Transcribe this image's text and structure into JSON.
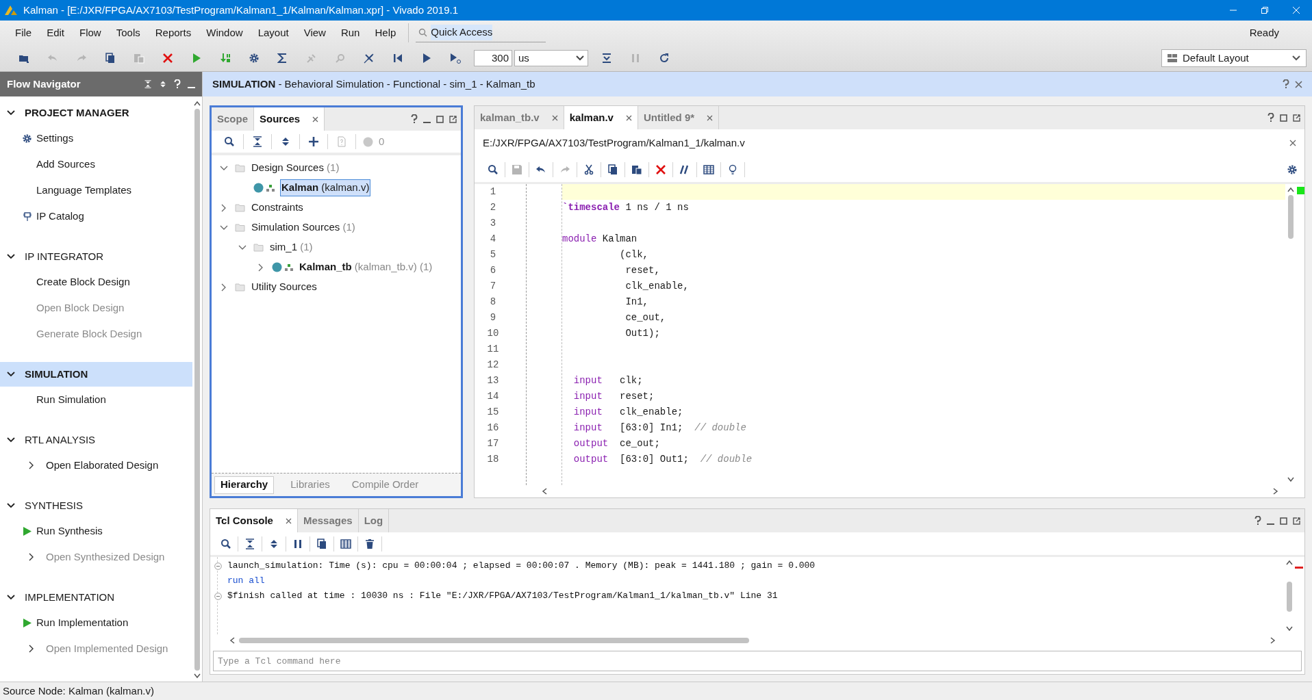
{
  "window": {
    "title": "Kalman - [E:/JXR/FPGA/AX7103/TestProgram/Kalman1_1/Kalman/Kalman.xpr] - Vivado 2019.1"
  },
  "menu": [
    "File",
    "Edit",
    "Flow",
    "Tools",
    "Reports",
    "Window",
    "Layout",
    "View",
    "Run",
    "Help"
  ],
  "quick_access": {
    "label": "Quick Access"
  },
  "status_text": "Ready",
  "toolbar": [
    {
      "kind": "open",
      "disabled": false
    },
    {
      "kind": "undo",
      "disabled": true
    },
    {
      "kind": "redo",
      "disabled": true
    },
    {
      "kind": "copy",
      "disabled": false
    },
    {
      "kind": "paste",
      "disabled": true
    },
    {
      "kind": "delete",
      "disabled": false
    },
    {
      "kind": "run",
      "disabled": false
    },
    {
      "kind": "bitstream",
      "disabled": false
    },
    {
      "kind": "settings",
      "disabled": false
    },
    {
      "kind": "sigma",
      "disabled": false
    },
    {
      "kind": "tool",
      "disabled": true
    },
    {
      "kind": "probe",
      "disabled": true
    },
    {
      "kind": "crossed",
      "disabled": false
    },
    {
      "kind": "restart",
      "disabled": false
    },
    {
      "kind": "play",
      "disabled": false
    },
    {
      "kind": "play_for",
      "disabled": false
    }
  ],
  "run_time": {
    "value": "300",
    "unit": "us"
  },
  "toolbar_end": [
    {
      "kind": "step",
      "disabled": false
    },
    {
      "kind": "pause",
      "disabled": true
    },
    {
      "kind": "refresh",
      "disabled": false
    }
  ],
  "layout_select": {
    "value": "Default Layout"
  },
  "flow_navigator": {
    "title": "Flow Navigator",
    "sections": [
      {
        "title": "PROJECT MANAGER",
        "expanded": true,
        "selected": false,
        "bold": true,
        "items": [
          {
            "label": "Settings",
            "kind": "settings",
            "disabled": false
          },
          {
            "label": "Add Sources",
            "kind": "plain",
            "disabled": false
          },
          {
            "label": "Language Templates",
            "kind": "plain",
            "disabled": false
          },
          {
            "label": "IP Catalog",
            "kind": "ip",
            "disabled": false
          }
        ]
      },
      {
        "title": "IP INTEGRATOR",
        "expanded": true,
        "selected": false,
        "bold": false,
        "items": [
          {
            "label": "Create Block Design",
            "kind": "plain",
            "disabled": false
          },
          {
            "label": "Open Block Design",
            "kind": "plain",
            "disabled": true
          },
          {
            "label": "Generate Block Design",
            "kind": "plain",
            "disabled": true
          }
        ]
      },
      {
        "title": "SIMULATION",
        "expanded": true,
        "selected": true,
        "bold": true,
        "items": [
          {
            "label": "Run Simulation",
            "kind": "plain",
            "disabled": false
          }
        ]
      },
      {
        "title": "RTL ANALYSIS",
        "expanded": true,
        "selected": false,
        "bold": false,
        "items": [
          {
            "label": "Open Elaborated Design",
            "kind": "expandable",
            "disabled": false
          }
        ]
      },
      {
        "title": "SYNTHESIS",
        "expanded": true,
        "selected": false,
        "bold": false,
        "items": [
          {
            "label": "Run Synthesis",
            "kind": "run",
            "disabled": false
          },
          {
            "label": "Open Synthesized Design",
            "kind": "expandable",
            "disabled": true
          }
        ]
      },
      {
        "title": "IMPLEMENTATION",
        "expanded": true,
        "selected": false,
        "bold": false,
        "items": [
          {
            "label": "Run Implementation",
            "kind": "run",
            "disabled": false
          },
          {
            "label": "Open Implemented Design",
            "kind": "expandable",
            "disabled": true
          }
        ]
      }
    ]
  },
  "header": {
    "text": "**SIMULATION** - Behavioral Simulation - Functional - sim_1 - Kalman_tb"
  },
  "sources_panel": {
    "tabs": [
      {
        "label": "Scope",
        "selected": false
      },
      {
        "label": "Sources",
        "selected": true
      }
    ],
    "toolbar": [
      {
        "kind": "search",
        "disabled": false
      },
      {
        "kind": "collapse",
        "disabled": false
      },
      {
        "kind": "expand",
        "disabled": false
      },
      {
        "kind": "add",
        "disabled": false
      },
      {
        "kind": "unknown",
        "disabled": true
      }
    ],
    "warning_count": "0",
    "tree": [
      {
        "name": "Design Sources",
        "detail": "(1)",
        "kind": "folder",
        "bold": false,
        "selected": false,
        "expanded": true,
        "children": [
          {
            "name": "Kalman",
            "detail": "(kalman.v)",
            "kind": "module",
            "bold": true,
            "selected": true
          }
        ]
      },
      {
        "name": "Constraints",
        "kind": "folder",
        "bold": false,
        "selected": false,
        "expanded": false
      },
      {
        "name": "Simulation Sources",
        "detail": "(1)",
        "kind": "folder",
        "bold": false,
        "selected": false,
        "expanded": true,
        "children": [
          {
            "name": "sim_1",
            "detail": "(1)",
            "kind": "folder",
            "bold": false,
            "selected": false,
            "expanded": true,
            "children": [
              {
                "name": "Kalman_tb",
                "detail": "(kalman_tb.v) (1)",
                "kind": "module",
                "bold": true,
                "selected": false,
                "expanded": false,
                "has_children": true
              }
            ]
          }
        ]
      },
      {
        "name": "Utility Sources",
        "kind": "folder",
        "bold": false,
        "selected": false,
        "expanded": false
      }
    ],
    "bottom_tabs": [
      {
        "label": "Hierarchy",
        "selected": true
      },
      {
        "label": "Libraries",
        "selected": false
      },
      {
        "label": "Compile Order",
        "selected": false
      }
    ]
  },
  "editor": {
    "tabs": [
      {
        "label": "kalman_tb.v",
        "selected": false
      },
      {
        "label": "kalman.v",
        "selected": true
      },
      {
        "label": "Untitled 9*",
        "selected": false
      }
    ],
    "path": "E:/JXR/FPGA/AX7103/TestProgram/Kalman1_1/kalman.v",
    "toolbar": [
      {
        "kind": "search",
        "disabled": false
      },
      {
        "kind": "save",
        "disabled": true
      },
      {
        "kind": "undo",
        "disabled": false
      },
      {
        "kind": "redo",
        "disabled": true
      },
      {
        "kind": "cut",
        "disabled": false
      },
      {
        "kind": "copy",
        "disabled": false
      },
      {
        "kind": "paste",
        "disabled": false
      },
      {
        "kind": "delete",
        "disabled": false
      },
      {
        "kind": "comment",
        "disabled": false
      },
      {
        "kind": "columns",
        "disabled": false
      },
      {
        "kind": "bulb",
        "disabled": false
      }
    ],
    "lines": [
      {
        "number": "1",
        "current": true
      },
      {
        "number": "2",
        "current": false,
        "tokens": [
          {
            "kind": "directive",
            "text": "`timescale"
          },
          {
            "kind": "plain",
            "text": " 1 ns / 1 ns"
          }
        ]
      },
      {
        "number": "3",
        "current": false
      },
      {
        "number": "4",
        "current": false,
        "tokens": [
          {
            "kind": "keyword",
            "text": "module"
          },
          {
            "kind": "plain",
            "text": " Kalman"
          }
        ]
      },
      {
        "number": "5",
        "current": false,
        "tokens": [
          {
            "kind": "plain",
            "text": "          (clk,"
          }
        ]
      },
      {
        "number": "6",
        "current": false,
        "tokens": [
          {
            "kind": "plain",
            "text": "           reset,"
          }
        ]
      },
      {
        "number": "7",
        "current": false,
        "tokens": [
          {
            "kind": "plain",
            "text": "           clk_enable,"
          }
        ]
      },
      {
        "number": "8",
        "current": false,
        "tokens": [
          {
            "kind": "plain",
            "text": "           In1,"
          }
        ]
      },
      {
        "number": "9",
        "current": false,
        "tokens": [
          {
            "kind": "plain",
            "text": "           ce_out,"
          }
        ]
      },
      {
        "number": "10",
        "current": false,
        "tokens": [
          {
            "kind": "plain",
            "text": "           Out1);"
          }
        ]
      },
      {
        "number": "11",
        "current": false
      },
      {
        "number": "12",
        "current": false
      },
      {
        "number": "13",
        "current": false,
        "tokens": [
          {
            "kind": "keyword",
            "text": "  input"
          },
          {
            "kind": "plain",
            "text": "   clk;"
          }
        ]
      },
      {
        "number": "14",
        "current": false,
        "tokens": [
          {
            "kind": "keyword",
            "text": "  input"
          },
          {
            "kind": "plain",
            "text": "   reset;"
          }
        ]
      },
      {
        "number": "15",
        "current": false,
        "tokens": [
          {
            "kind": "keyword",
            "text": "  input"
          },
          {
            "kind": "plain",
            "text": "   clk_enable;"
          }
        ]
      },
      {
        "number": "16",
        "current": false,
        "tokens": [
          {
            "kind": "keyword",
            "text": "  input"
          },
          {
            "kind": "plain",
            "text": "   [63:0] In1;  "
          },
          {
            "kind": "comment",
            "text": "// double"
          }
        ]
      },
      {
        "number": "17",
        "current": false,
        "tokens": [
          {
            "kind": "keyword",
            "text": "  output"
          },
          {
            "kind": "plain",
            "text": "  ce_out;"
          }
        ]
      },
      {
        "number": "18",
        "current": false,
        "tokens": [
          {
            "kind": "keyword",
            "text": "  output"
          },
          {
            "kind": "plain",
            "text": "  [63:0] Out1;  "
          },
          {
            "kind": "comment",
            "text": "// double"
          }
        ]
      }
    ]
  },
  "console": {
    "tabs": [
      {
        "label": "Tcl Console",
        "selected": true
      },
      {
        "label": "Messages",
        "selected": false
      },
      {
        "label": "Log",
        "selected": false
      }
    ],
    "toolbar": [
      {
        "kind": "search",
        "disabled": false
      },
      {
        "kind": "collapse",
        "disabled": false
      },
      {
        "kind": "expand",
        "disabled": false
      },
      {
        "kind": "pause",
        "disabled": false
      },
      {
        "kind": "copy",
        "disabled": false
      },
      {
        "kind": "columns",
        "disabled": false
      },
      {
        "kind": "trash",
        "disabled": false
      }
    ],
    "lines": [
      {
        "kind": "output",
        "text": "launch_simulation: Time (s): cpu = 00:00:04 ; elapsed = 00:00:07 . Memory (MB): peak = 1441.180 ; gain = 0.000"
      },
      {
        "kind": "command",
        "text": "run all"
      },
      {
        "kind": "output",
        "text": "$finish called at time : 10030 ns : File \"E:/JXR/FPGA/AX7103/TestProgram/Kalman1_1/kalman_tb.v\" Line 31"
      }
    ],
    "input": {
      "placeholder": "Type a Tcl command here"
    }
  },
  "status_bar": {
    "text": "Source Node: Kalman (kalman.v)"
  }
}
